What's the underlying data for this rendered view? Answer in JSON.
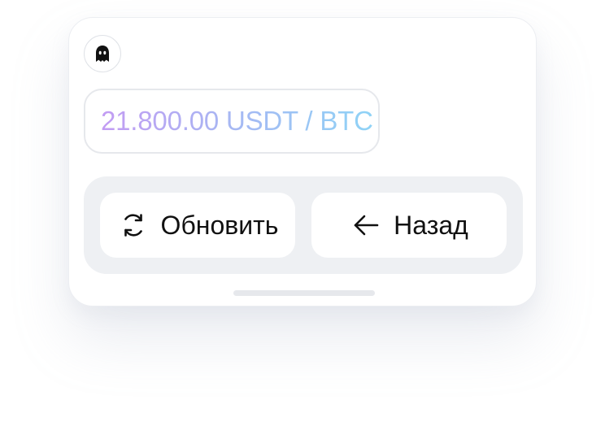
{
  "header": {
    "avatar_icon": "ghost-icon"
  },
  "price": {
    "text": "21.800.00 USDT / BTC",
    "gradient_start": "#c39cf3",
    "gradient_end": "#8fd3f6"
  },
  "actions": {
    "refresh": {
      "label": "Обновить",
      "icon": "refresh-icon"
    },
    "back": {
      "label": "Назад",
      "icon": "arrow-left-icon"
    }
  },
  "colors": {
    "panel_background": "#eef0f3",
    "text": "#111111",
    "border": "#e6e8ec"
  }
}
